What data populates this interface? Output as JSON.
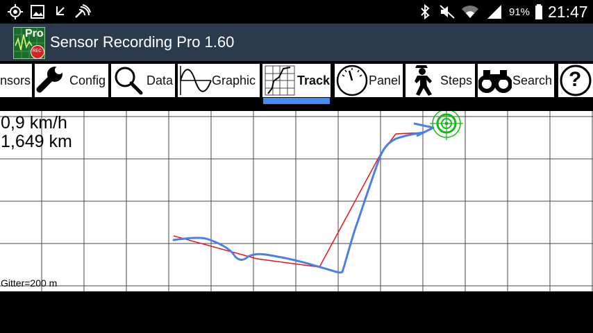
{
  "status_bar": {
    "battery_percent": "91%",
    "time": "21:47",
    "icons": [
      "gps-icon",
      "image-icon",
      "call-missed-icon",
      "nfc-icon",
      "bluetooth-icon",
      "mute-icon",
      "wifi-icon",
      "signal-icon",
      "battery-icon"
    ]
  },
  "app": {
    "title": "Sensor Recording Pro 1.60",
    "logo_text": "Pro",
    "logo_badge": "REC"
  },
  "tabs": [
    {
      "label": "nsors",
      "icon": "sensors-icon",
      "selected": false
    },
    {
      "label": "Config",
      "icon": "wrench-icon",
      "selected": false
    },
    {
      "label": "Data",
      "icon": "magnifier-icon",
      "selected": false
    },
    {
      "label": "Graphic",
      "icon": "sine-wave-icon",
      "selected": false
    },
    {
      "label": "Track",
      "icon": "track-map-icon",
      "selected": true
    },
    {
      "label": "Panel",
      "icon": "gauge-icon",
      "selected": false
    },
    {
      "label": "Steps",
      "icon": "walking-man-icon",
      "selected": false
    },
    {
      "label": "Search",
      "icon": "binoculars-icon",
      "selected": false
    },
    {
      "label": "?",
      "icon": "help-icon",
      "selected": false
    }
  ],
  "track": {
    "speed": "0,9 km/h",
    "distance": "1,649 km",
    "grid_label": "Gitter=200 m",
    "colors": {
      "gps_track": "#ee1111",
      "filtered_track": "#4a7fe6",
      "target": "#11bb11"
    }
  }
}
